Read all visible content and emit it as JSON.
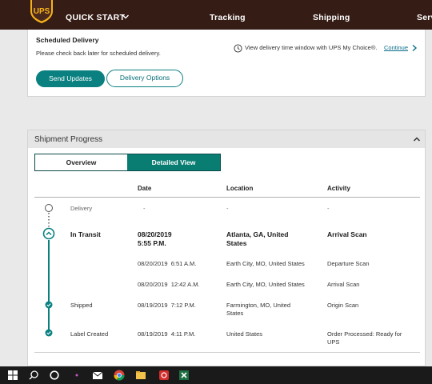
{
  "nav": {
    "quick_start": "QUICK START",
    "links": [
      "Tracking",
      "Shipping",
      "Serv"
    ],
    "brand_color": "#351c15",
    "logo_text": "UPS"
  },
  "scheduled": {
    "title": "Scheduled Delivery",
    "text": "Please check back later for scheduled delivery.",
    "mychoice_text": "View delivery time window with UPS My Choice®.",
    "mychoice_link": "Continue",
    "send_updates": "Send Updates",
    "delivery_options": "Delivery Options",
    "accent": "#0a8080"
  },
  "progress": {
    "title": "Shipment Progress",
    "toggle": {
      "overview": "Overview",
      "detailed": "Detailed View"
    },
    "headers": [
      "Date",
      "Location",
      "Activity"
    ],
    "rows": [
      {
        "status": "Delivery",
        "date": "-",
        "location": "-",
        "activity": "-"
      },
      {
        "status": "In Transit",
        "date_line1": "08/20/2019",
        "date_line2": "5:55 P.M.",
        "location_line1": "Atlanta, GA, United",
        "location_line2": "States",
        "activity": "Arrival Scan"
      },
      {
        "status": "",
        "date": "08/20/2019  6:51 A.M.",
        "location": "Earth City, MO, United States",
        "activity": "Departure Scan"
      },
      {
        "status": "",
        "date": "08/20/2019  12:42 A.M.",
        "location": "Earth City, MO, United States",
        "activity": "Arrival Scan"
      },
      {
        "status": "Shipped",
        "date": "08/19/2019  7:12 P.M.",
        "location_line1": "Farmington, MO, United",
        "location_line2": "States",
        "activity": "Origin Scan"
      },
      {
        "status": "Label Created",
        "date": "08/19/2019  4:11 P.M.",
        "location": "United States",
        "activity_line1": "Order Processed: Ready for",
        "activity_line2": "UPS"
      }
    ]
  },
  "taskbar": {
    "icons": [
      "windows-start-icon",
      "search-icon",
      "cortana-icon",
      "app-icon",
      "mail-icon",
      "chrome-icon",
      "file-explorer-icon",
      "app-red-icon",
      "excel-icon"
    ]
  }
}
